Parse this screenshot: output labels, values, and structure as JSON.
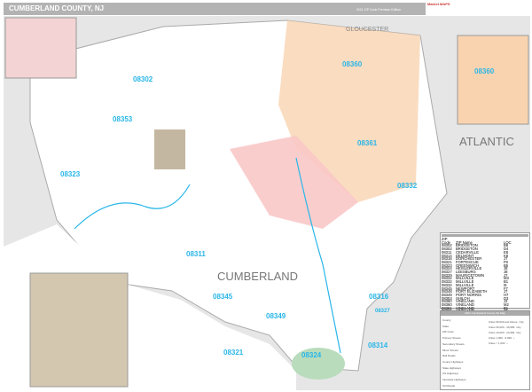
{
  "header": {
    "title": "CUMBERLAND COUNTY, NJ",
    "edition": "2021 ZIP Code Premium Edition",
    "logo": "Market MAPS"
  },
  "map": {
    "county_label": "CUMBERLAND",
    "region_labels": [
      "GLOUCESTER",
      "ATLANTIC"
    ],
    "zip_labels": [
      "08302",
      "08353",
      "08323",
      "08311",
      "08345",
      "08349",
      "08321",
      "08324",
      "08314",
      "08316",
      "08327",
      "08332",
      "08361",
      "08360",
      "08360"
    ],
    "colors": {
      "zip_08360": "#f9d3b0",
      "zip_08361": "#f9c8c8",
      "zip_08353": "#b5a58a",
      "water": "#ffffff",
      "land": "#e6e6e6",
      "label": "#29b6e8"
    }
  },
  "zip_table": {
    "title": "ZIP Code Index",
    "headers": [
      "ZIP Code",
      "ZIP Name",
      "LOC"
    ],
    "rows": [
      [
        "08302",
        "BRIDGETON",
        "B8"
      ],
      [
        "08302",
        "BRIDGETON",
        "D4"
      ],
      [
        "08311",
        "CEDARVILLE",
        "E8"
      ],
      [
        "08314",
        "DELMONT",
        "K8"
      ],
      [
        "08316",
        "DORCHESTER",
        "J7"
      ],
      [
        "08321",
        "FORTESCUE",
        "F8"
      ],
      [
        "08323",
        "GREENWICH",
        "B5"
      ],
      [
        "08324",
        "HEISLERVILLE",
        "J8"
      ],
      [
        "08327",
        "LEESBURG",
        "J8"
      ],
      [
        "08329",
        "MAURICETOWN",
        "J7"
      ],
      [
        "08332",
        "MILLVILLE",
        "M3"
      ],
      [
        "08332",
        "MILLVILLE",
        "B1"
      ],
      [
        "08332",
        "MILLVILLE",
        "I5"
      ],
      [
        "08345",
        "NEWPORT",
        "F7"
      ],
      [
        "08348",
        "PORT ELIZABETH",
        "J7"
      ],
      [
        "08349",
        "PORT NORRIS",
        "H7"
      ],
      [
        "08353",
        "SHILOH",
        "D3"
      ],
      [
        "08360",
        "VINELAND",
        "J2"
      ],
      [
        "08360",
        "VINELAND",
        "M2"
      ],
      [
        "08361",
        "VINELAND",
        "B1"
      ],
      [
        "08361",
        "VINELAND",
        "J3"
      ],
      [
        "08361",
        "VINELAND",
        "N2"
      ]
    ]
  },
  "legend": {
    "title": "2021 Cumberland County Zip Map",
    "items": [
      "County",
      "State",
      "ZIP Code",
      "Primary Streets",
      "Secondary Streets",
      "Minor Streets",
      "Rail Roads",
      "County Highways",
      "State Highways",
      "US Highways",
      "Interstate Highways",
      "Toll Roads"
    ],
    "city_items": [
      "Cities 50,000 and Above",
      "Cities 25,000 - 49,999",
      "Cities 10,000 - 24,999",
      "Cities 1,000 - 9,999",
      "Cities < 1,000"
    ],
    "city_glyphs": [
      "City",
      "City",
      "City",
      "•",
      "•"
    ]
  }
}
